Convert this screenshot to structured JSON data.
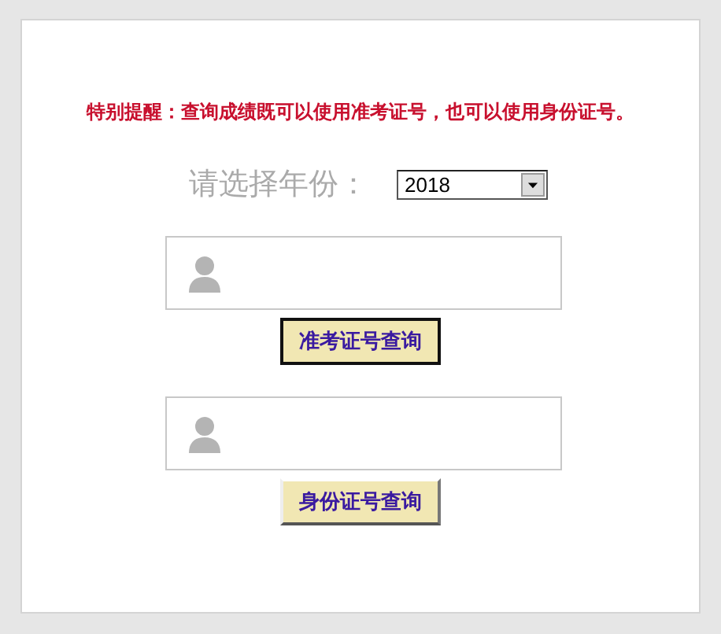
{
  "notice": "特别提醒：查询成绩既可以使用准考证号，也可以使用身份证号。",
  "year_select": {
    "label": "请选择年份：",
    "value": "2018"
  },
  "queries": [
    {
      "button": "准考证号查询",
      "focused": true
    },
    {
      "button": "身份证号查询",
      "focused": false
    }
  ]
}
